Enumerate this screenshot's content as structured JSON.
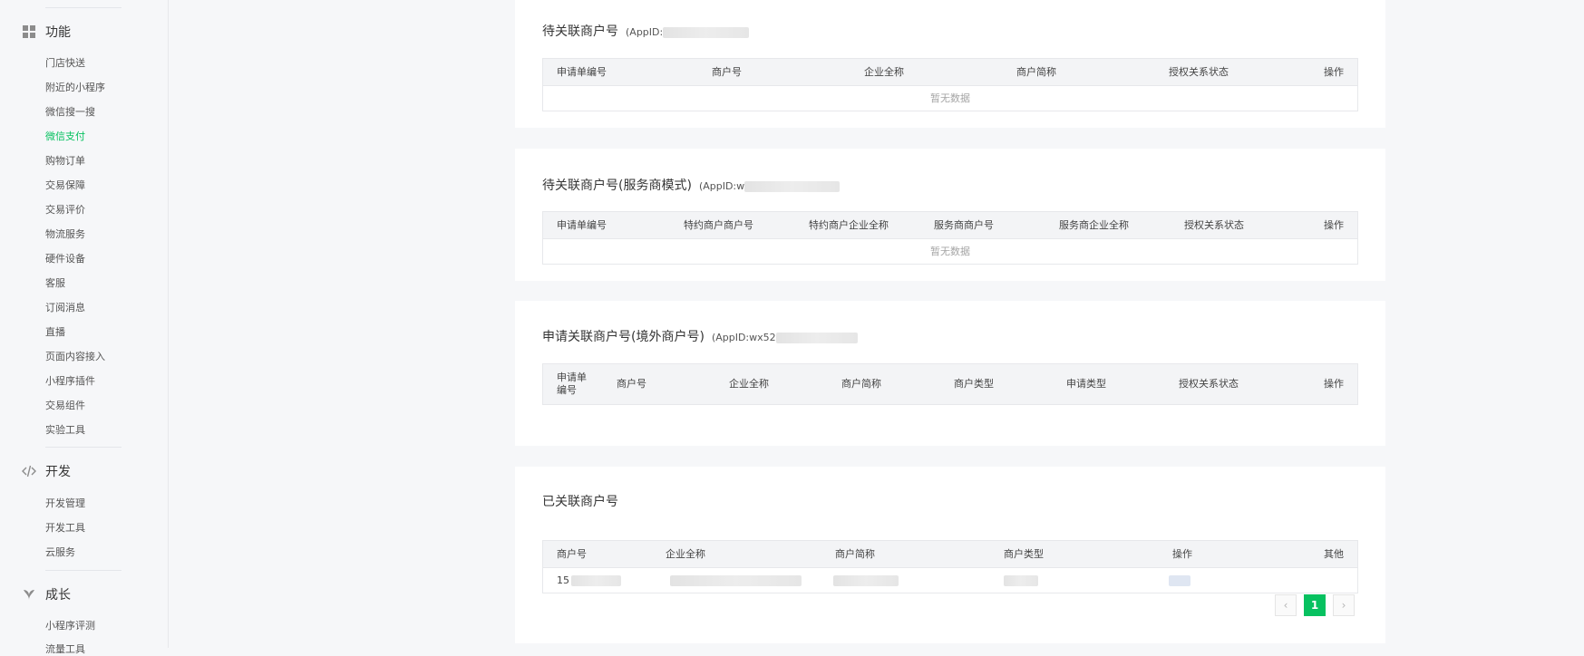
{
  "sidebar": {
    "groups": {
      "features": {
        "label": "功能"
      },
      "dev": {
        "label": "开发"
      },
      "growth": {
        "label": "成长"
      }
    },
    "feature_items": [
      "门店快送",
      "附近的小程序",
      "微信搜一搜",
      "微信支付",
      "购物订单",
      "交易保障",
      "交易评价",
      "物流服务",
      "硬件设备",
      "客服",
      "订阅消息",
      "直播",
      "页面内容接入",
      "小程序插件",
      "交易组件",
      "实验工具"
    ],
    "dev_items": [
      "开发管理",
      "开发工具",
      "云服务"
    ],
    "growth_items": [
      "小程序评测",
      "流量工具"
    ],
    "active_item": "微信支付"
  },
  "section1": {
    "title": "待关联商户号",
    "appid_prefix": "(AppID:",
    "headers": [
      "申请单编号",
      "商户号",
      "企业全称",
      "商户简称",
      "授权关系状态",
      "操作"
    ],
    "empty_text": "暂无数据"
  },
  "section2": {
    "title": "待关联商户号(服务商模式)",
    "appid_prefix": "(AppID:w",
    "headers": [
      "申请单编号",
      "特约商户商户号",
      "特约商户企业全称",
      "服务商商户号",
      "服务商企业全称",
      "授权关系状态",
      "操作"
    ],
    "empty_text": "暂无数据"
  },
  "section3": {
    "title": "申请关联商户号(境外商户号)",
    "appid_prefix": "(AppID:wx52",
    "headers": [
      "申请单编号",
      "商户号",
      "企业全称",
      "商户简称",
      "商户类型",
      "申请类型",
      "授权关系状态",
      "操作"
    ]
  },
  "section4": {
    "title": "已关联商户号",
    "headers": [
      "商户号",
      "企业全称",
      "商户简称",
      "商户类型",
      "操作",
      "其他"
    ],
    "row": {
      "merchant_id_prefix": "15"
    }
  },
  "pagination": {
    "prev": "‹",
    "current": "1",
    "next": "›"
  },
  "colors": {
    "accent": "#07c160"
  }
}
